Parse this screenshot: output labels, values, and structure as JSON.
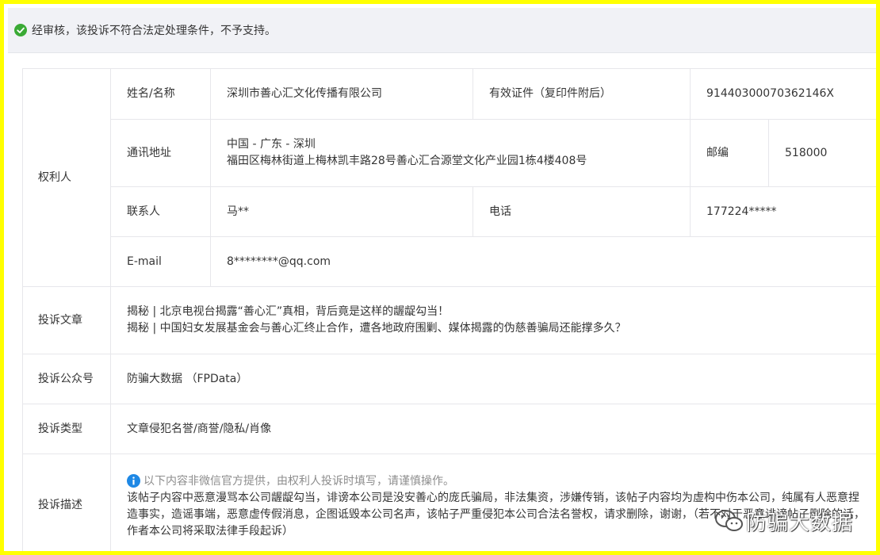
{
  "banner": {
    "status_icon": "check-circle-icon",
    "status_color": "#3aaa35",
    "text": "经审核，该投诉不符合法定处理条件，不予支持。"
  },
  "rights_holder": {
    "section_label": "权利人",
    "name_label": "姓名/名称",
    "name_value": "深圳市善心汇文化传播有限公司",
    "id_label": "有效证件（复印件附后）",
    "id_value": "91440300070362146X",
    "address_label": "通讯地址",
    "address_line1": "中国 - 广东 - 深圳",
    "address_line2": "福田区梅林街道上梅林凯丰路28号善心汇合源堂文化产业园1栋4楼408号",
    "postcode_label": "邮编",
    "postcode_value": "518000",
    "contact_label": "联系人",
    "contact_value": "马**",
    "phone_label": "电话",
    "phone_value": "177224*****",
    "email_label": "E-mail",
    "email_value": "8********@qq.com"
  },
  "article": {
    "label": "投诉文章",
    "lines": [
      "揭秘 | 北京电视台揭露“善心汇”真相，背后竟是这样的龌龊勾当！",
      "揭秘 | 中国妇女发展基金会与善心汇终止合作，遭各地政府围剿、媒体揭露的伪慈善骗局还能撑多久？"
    ]
  },
  "account": {
    "label": "投诉公众号",
    "value": "防骗大数据 （FPData）"
  },
  "type": {
    "label": "投诉类型",
    "value": "文章侵犯名誉/商誉/隐私/肖像"
  },
  "description": {
    "label": "投诉描述",
    "info_icon": "info-circle-icon",
    "info_color": "#1e88e5",
    "notice": "以下内容非微信官方提供，由权利人投诉时填写，请谨慎操作。",
    "text": "该帖子内容中恶意漫骂本公司龌龊勾当，诽谤本公司是没安善心的庞氏骗局，非法集资，涉嫌传销，该帖子内容均为虚构中伤本公司，纯属有人恶意捏造事实，造谣事端，恶意虚传假消息，企图诋毁本公司名声，该帖子严重侵犯本公司合法名誉权，请求删除，谢谢，（若不对于恶意诽谤帖子删除的话，作者本公司将采取法律手段起诉）"
  },
  "watermark": {
    "logo_icon": "wechat-icon",
    "text": "防骗大数据"
  }
}
